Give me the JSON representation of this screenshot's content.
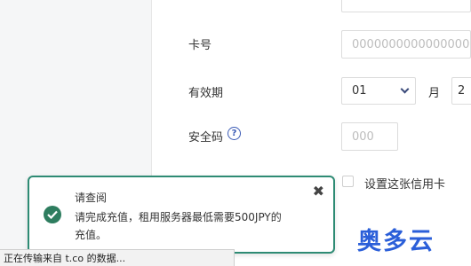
{
  "form": {
    "card_number": {
      "label": "卡号",
      "placeholder": "0000000000000000"
    },
    "expiry": {
      "label": "有效期",
      "month_value": "01",
      "month_unit": "月",
      "year_value": "2"
    },
    "cvv": {
      "label": "安全码",
      "help_icon": "?",
      "placeholder": "000"
    },
    "set_default_card_label": "设置这张信用卡"
  },
  "toast": {
    "title": "请查阅",
    "message": "请完成充值，租用服务器最低需要500JPY的充值。",
    "close_icon": "✖",
    "accent_color": "#2e8b74"
  },
  "statusbar": {
    "text": "正在传输来自 t.co 的数据..."
  },
  "watermark": {
    "text": "奥多云"
  }
}
